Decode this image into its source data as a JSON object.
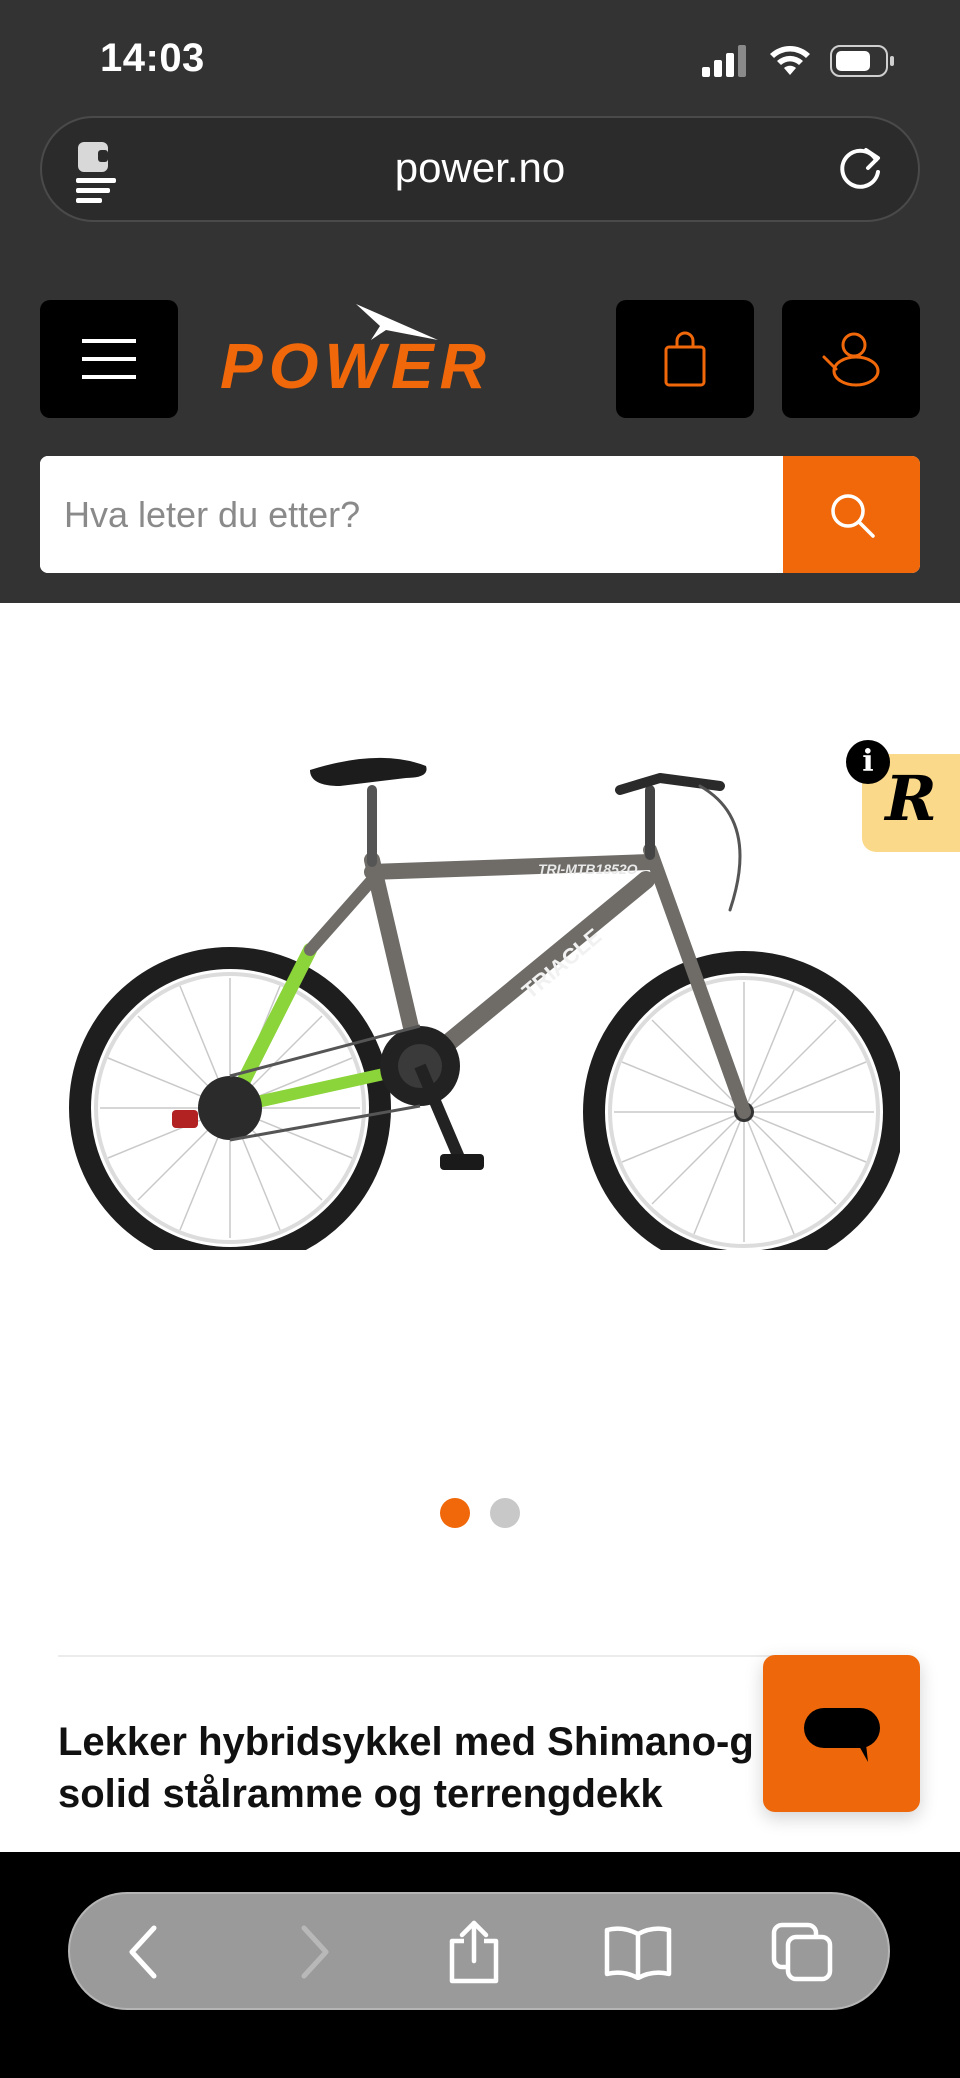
{
  "status_bar": {
    "time": "14:03",
    "icons": [
      "signal-icon",
      "wifi-icon",
      "battery-icon"
    ]
  },
  "browser": {
    "url": "power.no",
    "left_icon": "page-menu-icon",
    "right_icon": "reload-icon",
    "toolbar": [
      "back-icon",
      "forward-icon",
      "share-icon",
      "bookmarks-icon",
      "tabs-icon"
    ]
  },
  "site_header": {
    "logo_text": "POWER",
    "menu_icon": "hamburger-icon",
    "cart_icon": "shopping-bag-icon",
    "account_icon": "user-icon",
    "search": {
      "placeholder": "Hva leter du etter?",
      "value": ""
    }
  },
  "product": {
    "image": "bicycle-image",
    "frame_text": "TRIACLE",
    "model_text": "TRI-MTB1852O",
    "carousel": {
      "count": 2,
      "active_index": 0
    },
    "title": "Lekker hybridsykkel med Shimano-g... solid stålramme og terrengdekk",
    "title_line1": "Lekker hybridsykkel med Shimano-g",
    "title_line2": "solid stålramme og terrengdekk",
    "badge_letter": "R",
    "info_letter": "i"
  },
  "colors": {
    "accent": "#f0680a",
    "header_bg": "#333333",
    "badge_bg": "#fbd98a"
  }
}
